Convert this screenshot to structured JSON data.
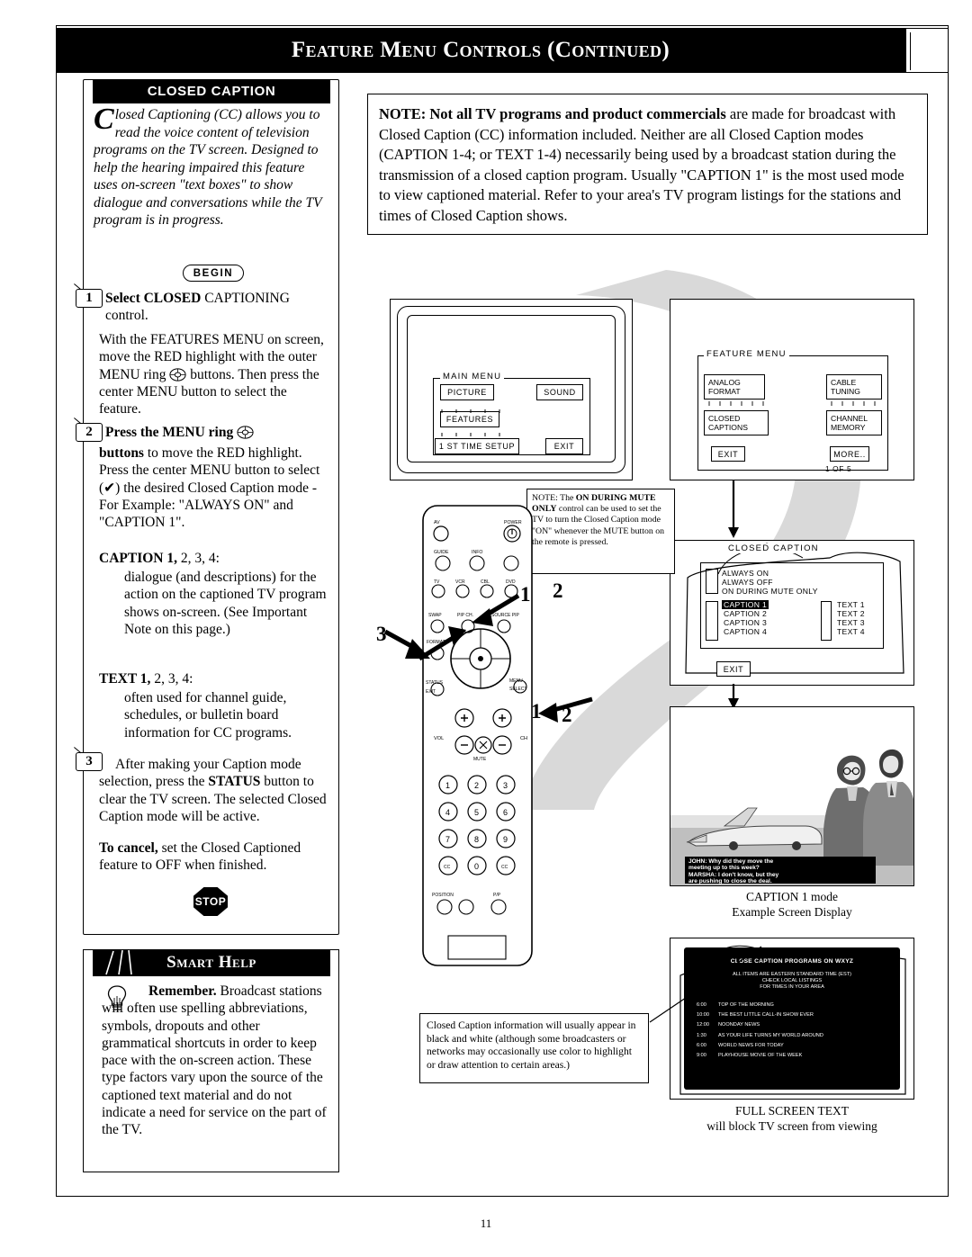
{
  "header": {
    "title": "Feature Menu Controls (Continued)"
  },
  "page_number": "11",
  "closed_caption_panel": {
    "title": "CLOSED CAPTION",
    "intro_dropcap": "C",
    "intro": "losed Captioning (CC) allows you to read the voice content of television programs on the TV screen. Designed to help the hearing impaired this feature uses on-screen \"text boxes\" to show dialogue and conversations while the TV program is in progress.",
    "begin_label": "BEGIN",
    "stop_label": "STOP",
    "steps": [
      {
        "num": "1",
        "heading_bold": "Select CLOSED",
        "heading_rest": "CAPTIONING control.",
        "body": "With the FEATURES MENU on screen, move the RED highlight with the outer MENU ring",
        "body2": "buttons. Then press the center MENU button to select the feature."
      },
      {
        "num": "2",
        "heading_bold": "Press the MENU ring",
        "body_bold": "buttons",
        "body": "to move the RED highlight. Press the center MENU button to select (",
        "body_after": ") the desired Closed Caption mode - For Example: \"ALWAYS ON\" and \"CAPTION 1\".",
        "caption_label_bold": "CAPTION 1,",
        "caption_label_rest": "2, 3, 4:",
        "caption_body": "dialogue (and descriptions) for the action on the captioned TV program shows on-screen. (See Important Note on this page.)",
        "text_label_bold": "TEXT 1,",
        "text_label_rest": "2, 3, 4:",
        "text_body": "often used for channel guide, schedules, or bulletin board information for CC programs."
      },
      {
        "num": "3",
        "body_a": "After making your Caption mode selection, press the ",
        "body_bold": "STATUS",
        "body_b": " button to clear the TV screen. The selected Closed Caption mode will be active.",
        "cancel_bold": "To cancel,",
        "cancel_rest": " set the Closed Captioned feature to OFF when finished."
      }
    ]
  },
  "smart_help": {
    "title": "Smart Help",
    "body_bold": "Remember.",
    "body": "Broadcast stations will often use spelling abbreviations, symbols, dropouts and other grammatical shortcuts in order to keep pace with the on-screen action. These type factors vary upon the source of the captioned text material and do not indicate a need for service on the part of the TV."
  },
  "note": {
    "bold_lead": "NOTE: Not all TV programs and product commercials",
    "body": " are made for broadcast with Closed Caption (CC) information included. Neither are all Closed Caption modes (CAPTION 1-4; or TEXT 1-4) necessarily being used by a broadcast station during the transmission of a closed caption program. Usually \"CAPTION 1\" is the most used mode to view captioned material. Refer to your area's TV program listings for the stations and times of Closed Caption shows."
  },
  "main_menu": {
    "legend": "MAIN MENU",
    "buttons": [
      "PICTURE",
      "SOUND",
      "FEATURES",
      "1 ST TIME SETUP",
      "EXIT"
    ]
  },
  "feature_menu": {
    "legend": "FEATURE MENU",
    "buttons": [
      "ANALOG FORMAT",
      "CABLE TUNING",
      "CLOSED CAPTIONS",
      "CHANNEL MEMORY",
      "EXIT",
      "MORE.."
    ],
    "pager": "1 OF 5"
  },
  "closed_caption_menu": {
    "legend": "CLOSED CAPTION",
    "group1": [
      "ALWAYS ON",
      "ALWAYS OFF",
      "ON DURING MUTE ONLY"
    ],
    "captions": [
      "CAPTION 1",
      "CAPTION 2",
      "CAPTION 3",
      "CAPTION 4"
    ],
    "texts": [
      "TEXT 1",
      "TEXT 2",
      "TEXT 3",
      "TEXT 4"
    ],
    "exit": "EXIT"
  },
  "mute_note": {
    "lead": "NOTE: The ",
    "bold1": "ON DURING",
    "bold2": "MUTE ONLY",
    "body": " control can be used to set the TV to turn the Closed Caption mode \"ON\" whenever the MUTE button on the remote is pressed."
  },
  "photo": {
    "caption_lines": [
      "JOHN: Why did they move  the",
      "meeting up to this week?",
      "MARSHA: I don't know, but they",
      "are pushing to close the deal."
    ],
    "under_line1": "CAPTION 1 mode",
    "under_line2": "Example Screen Display"
  },
  "full_screen_text": {
    "title": "CLOSE CAPTION PROGRAMS ON WXYZ",
    "subtitle": [
      "ALL ITEMS ARE EASTERN STANDARD TIME (EST)",
      "CHECK LOCAL LISTINGS",
      "FOR TIMES IN YOUR AREA"
    ],
    "rows": [
      {
        "time": "6:00",
        "text": "TOP OF THE MORNING"
      },
      {
        "time": "10:00",
        "text": "THE BEST LITTLE CALL-IN SHOW EVER"
      },
      {
        "time": "12:00",
        "text": "NOONDAY NEWS"
      },
      {
        "time": "1:30",
        "text": "AS YOUR LIFE TURNS MY WORLD AROUND"
      },
      {
        "time": "6:00",
        "text": "WORLD NEWS FOR TODAY"
      },
      {
        "time": "9:00",
        "text": "PLAYHOUSE MOVIE OF THE WEEK"
      }
    ],
    "under_line1": "FULL SCREEN TEXT",
    "under_line2": "will block TV screen from viewing"
  },
  "bottom_note": {
    "text": "Closed Caption information will usually appear in black and white (although some broadcasters or networks may occasionally use color to highlight or draw attention to certain areas.)"
  },
  "remote": {
    "labels": {
      "av": "AV",
      "power": "POWER",
      "guide": "GUIDE",
      "info": "INFO",
      "tv": "TV",
      "vcr": "VCR",
      "cbl": "CBL",
      "dvd": "DVD",
      "swap": "SWAP",
      "pip_ch": "PIP CH.",
      "source_pip": "SOURCE PIP",
      "format": "FORMAT",
      "status": "STATUS",
      "exit": "EXIT",
      "menu": "MENU",
      "select": "SELECT",
      "vol": "VOL",
      "mute": "MUTE",
      "ch": "CH",
      "position": "POSITION",
      "pip": "P/P"
    },
    "keypad": [
      "1",
      "2",
      "3",
      "4",
      "5",
      "6",
      "7",
      "8",
      "9",
      "0"
    ],
    "keypad_extra": [
      "CC",
      "CC",
      "0",
      "CC"
    ]
  },
  "callouts": {
    "a1": "1",
    "a2": "2",
    "a3": "3",
    "b1": "1",
    "b2": "2"
  }
}
